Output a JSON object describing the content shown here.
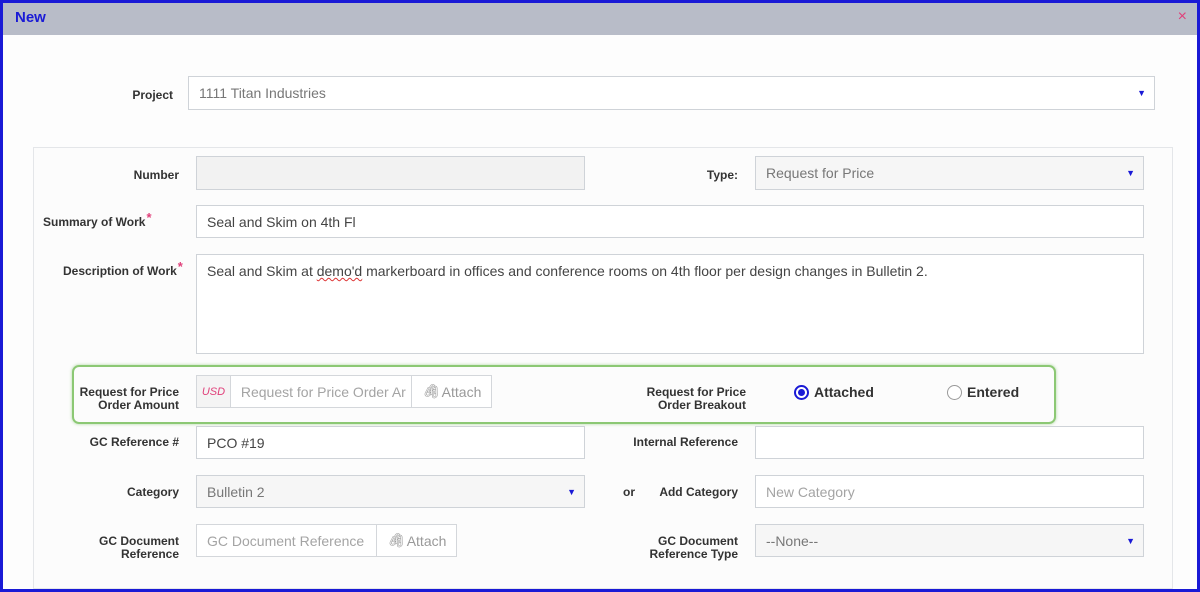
{
  "dialog": {
    "title": "New",
    "close": "×"
  },
  "project": {
    "label": "Project",
    "value": "1111 Titan Industries"
  },
  "number": {
    "label": "Number",
    "value": ""
  },
  "type": {
    "label": "Type:",
    "value": "Request for Price"
  },
  "summary": {
    "label": "Summary of Work",
    "required": "*",
    "value": "Seal and Skim on 4th Fl"
  },
  "description": {
    "label": "Description of Work",
    "required": "*",
    "value_before": "Seal and Skim at ",
    "value_spell": "demo'd",
    "value_after": " markerboard in offices and conference rooms on 4th floor per design changes in Bulletin 2."
  },
  "rfp_amount": {
    "label_line1": "Request for Price",
    "label_line2": "Order Amount",
    "currency": "USD",
    "placeholder": "Request for Price Order Ar",
    "attach": "Attach"
  },
  "rfp_breakdown": {
    "label_line1": "Request for Price",
    "label_line2": "Order Breakout",
    "options": [
      "Attached",
      "Entered"
    ],
    "selected": "Attached"
  },
  "gc_reference": {
    "label": "GC Reference #",
    "value": "PCO #19"
  },
  "internal_reference": {
    "label": "Internal Reference",
    "value": ""
  },
  "category": {
    "label": "Category",
    "value": "Bulletin 2"
  },
  "or_text": "or",
  "add_category": {
    "label": "Add Category",
    "placeholder": "New Category"
  },
  "gc_document": {
    "label_line1": "GC Document",
    "label_line2": "Reference",
    "placeholder": "GC Document Reference",
    "attach": "Attach"
  },
  "gc_document_type": {
    "label_line1": "GC Document",
    "label_line2": "Reference Type",
    "value": "--None--"
  },
  "colors": {
    "accent": "#1a1ad6",
    "required": "#e0407a",
    "highlight": "#8cc874"
  },
  "icons": {
    "dropdown": "caret-down-icon",
    "attach": "paperclip-icon",
    "close": "close-icon"
  }
}
